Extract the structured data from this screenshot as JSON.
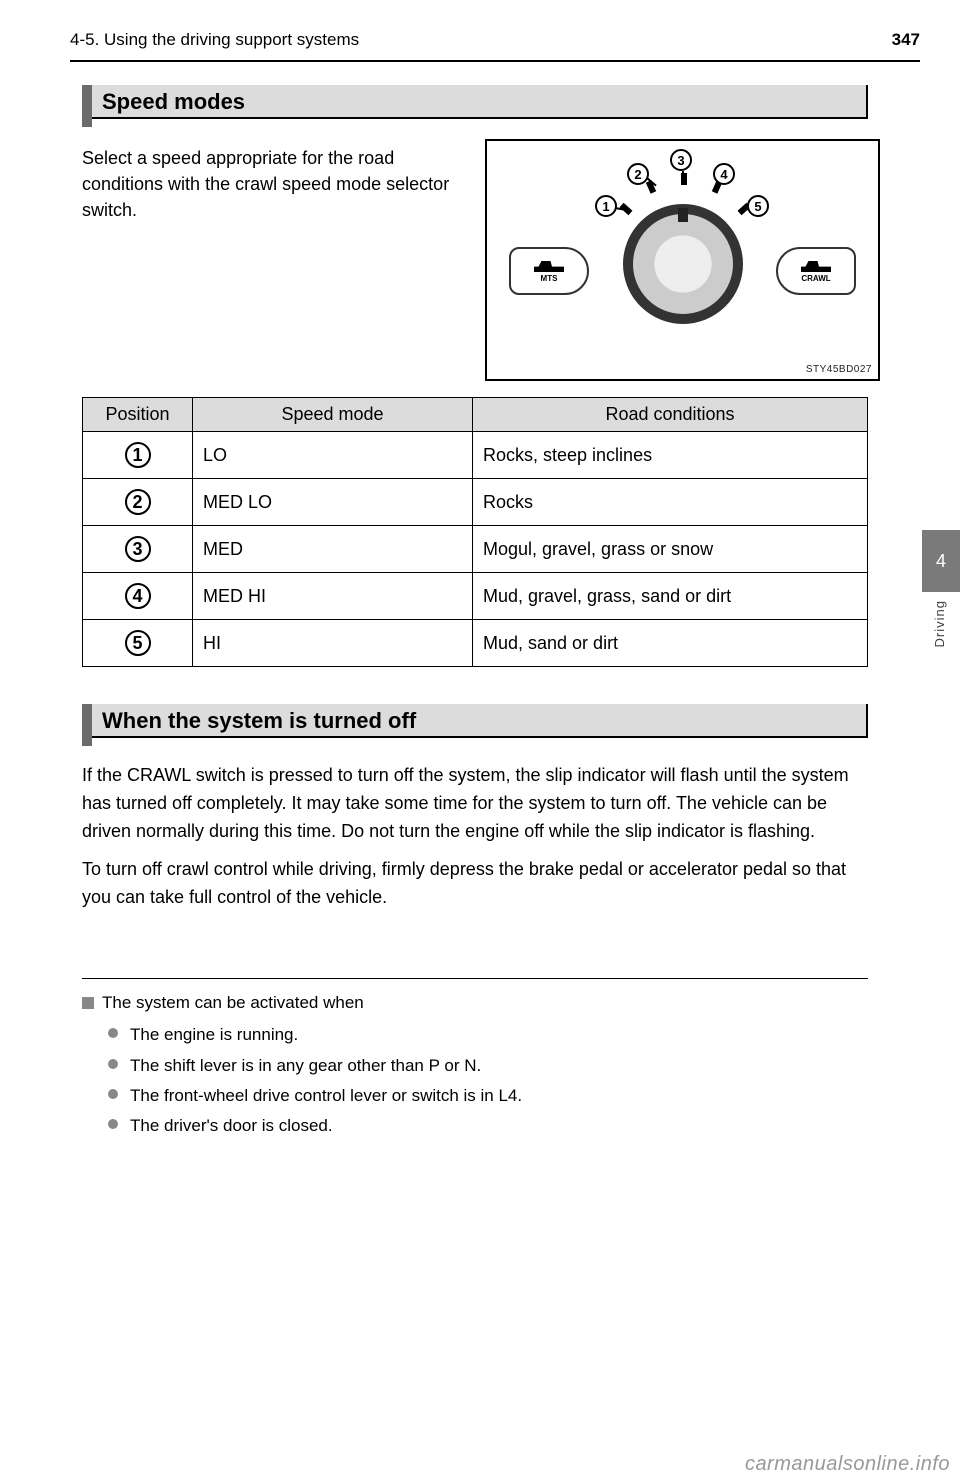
{
  "header": {
    "page_number": "347",
    "crumb": "4-5. Using the driving support systems"
  },
  "side_tab": {
    "number": "4",
    "label": "Driving"
  },
  "section1": {
    "title": "Speed modes",
    "intro": "Select a speed appropriate for the road conditions with the crawl speed mode selector switch.",
    "figure": {
      "left_button": "MTS",
      "right_button": "CRAWL",
      "code": "STY45BD027",
      "callouts": [
        "1",
        "2",
        "3",
        "4",
        "5"
      ]
    },
    "table": {
      "headers": {
        "position": "Position",
        "mode": "Speed mode",
        "road": "Road conditions"
      },
      "rows": [
        {
          "pos": "1",
          "mode": "LO",
          "road": "Rocks, steep inclines"
        },
        {
          "pos": "2",
          "mode": "MED LO",
          "road": "Rocks"
        },
        {
          "pos": "3",
          "mode": "MED",
          "road": "Mogul, gravel, grass or snow"
        },
        {
          "pos": "4",
          "mode": "MED HI",
          "road": "Mud, gravel, grass, sand or dirt"
        },
        {
          "pos": "5",
          "mode": "HI",
          "road": "Mud, sand or dirt"
        }
      ]
    }
  },
  "section2": {
    "title": "When the system is turned off",
    "p1": "If the CRAWL switch is pressed to turn off the system, the slip indicator will flash until the system has turned off completely. It may take some time for the system to turn off. The vehicle can be driven normally during this time. Do not turn the engine off while the slip indicator is flashing.",
    "p2": "To turn off crawl control while driving, firmly depress the brake pedal or accelerator pedal so that you can take full control of the vehicle."
  },
  "conditions": {
    "title": "The system can be activated when",
    "items": [
      "The engine is running.",
      "The shift lever is in any gear other than P or N.",
      "The front-wheel drive control lever or switch is in L4.",
      "The driver's door is closed."
    ]
  },
  "watermark": "carmanualsonline.info"
}
